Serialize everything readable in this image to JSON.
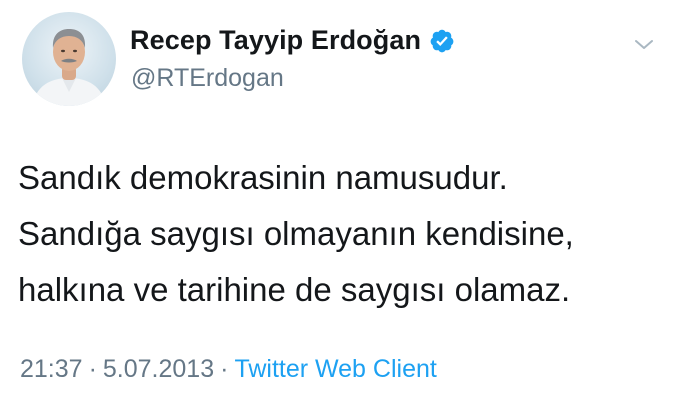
{
  "user": {
    "display_name": "Recep Tayyip Erdoğan",
    "handle": "@RTErdogan",
    "verified": true
  },
  "tweet": {
    "lines": [
      "Sandık demokrasinin namusudur.",
      "Sandığa saygısı olmayanın kendisine,",
      "halkına ve tarihine de saygısı olamaz."
    ],
    "time": "21:37",
    "separator": "·",
    "date": "5.07.2013",
    "client": "Twitter Web Client"
  },
  "icons": {
    "verified": "verified-badge-icon",
    "menu": "chevron-down-icon"
  },
  "colors": {
    "text": "#14171a",
    "secondary": "#657786",
    "link": "#1da1f2",
    "verified": "#1da1f2"
  }
}
